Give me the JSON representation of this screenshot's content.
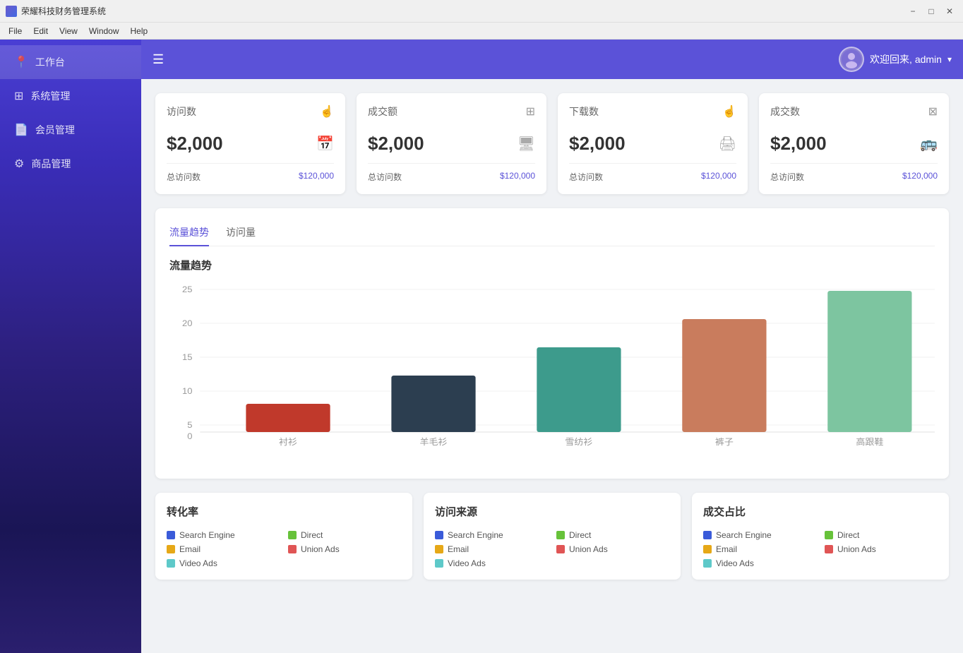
{
  "titleBar": {
    "title": "荣耀科技财务管理系统",
    "controls": [
      "minimize",
      "maximize",
      "close"
    ]
  },
  "menuBar": {
    "items": [
      "File",
      "Edit",
      "View",
      "Window",
      "Help"
    ]
  },
  "sidebar": {
    "items": [
      {
        "id": "workspace",
        "label": "工作台",
        "icon": "📍",
        "active": true
      },
      {
        "id": "system",
        "label": "系统管理",
        "icon": "⚙️",
        "active": false
      },
      {
        "id": "member",
        "label": "会员管理",
        "icon": "📄",
        "active": false
      },
      {
        "id": "product",
        "label": "商品管理",
        "icon": "⚙️",
        "active": false
      }
    ]
  },
  "header": {
    "welcome": "欢迎回来, admin"
  },
  "statCards": [
    {
      "title": "访问数",
      "value": "$2,000",
      "footerLabel": "总访问数",
      "footerValue": "$120,000",
      "icon": "☝",
      "icon2": "📅"
    },
    {
      "title": "成交额",
      "value": "$2,000",
      "footerLabel": "总访问数",
      "footerValue": "$120,000",
      "icon": "⬜",
      "icon2": "🖥"
    },
    {
      "title": "下载数",
      "value": "$2,000",
      "footerLabel": "总访问数",
      "footerValue": "$120,000",
      "icon": "☝",
      "icon2": "🖨"
    },
    {
      "title": "成交数",
      "value": "$2,000",
      "footerLabel": "总访问数",
      "footerValue": "$120,000",
      "icon": "⬜",
      "icon2": "🚌"
    }
  ],
  "chartSection": {
    "tabs": [
      "流量趋势",
      "访问量"
    ],
    "activeTab": 0,
    "title": "流量趋势",
    "yLabels": [
      "25",
      "20",
      "15",
      "10",
      "5",
      "0"
    ],
    "bars": [
      {
        "label": "衬衫",
        "value": 5,
        "color": "#c0392b",
        "maxValue": 25
      },
      {
        "label": "羊毛衫",
        "value": 10,
        "color": "#2c3e50",
        "maxValue": 25
      },
      {
        "label": "雪纺衫",
        "value": 15,
        "color": "#3d9b8c",
        "maxValue": 25
      },
      {
        "label": "裤子",
        "value": 20,
        "color": "#c97c5d",
        "maxValue": 25
      },
      {
        "label": "高跟鞋",
        "value": 25,
        "color": "#7dc5a0",
        "maxValue": 25
      }
    ]
  },
  "bottomCards": [
    {
      "title": "转化率",
      "legends": [
        {
          "label": "Search Engine",
          "color": "#3a5bd9"
        },
        {
          "label": "Direct",
          "color": "#67c23a"
        },
        {
          "label": "Email",
          "color": "#e6a817"
        },
        {
          "label": "Union Ads",
          "color": "#e05555"
        },
        {
          "label": "Video Ads",
          "color": "#5ec9c9"
        }
      ]
    },
    {
      "title": "访问来源",
      "legends": [
        {
          "label": "Search Engine",
          "color": "#3a5bd9"
        },
        {
          "label": "Direct",
          "color": "#67c23a"
        },
        {
          "label": "Email",
          "color": "#e6a817"
        },
        {
          "label": "Union Ads",
          "color": "#e05555"
        },
        {
          "label": "Video Ads",
          "color": "#5ec9c9"
        }
      ]
    },
    {
      "title": "成交占比",
      "legends": [
        {
          "label": "Search Engine",
          "color": "#3a5bd9"
        },
        {
          "label": "Direct",
          "color": "#67c23a"
        },
        {
          "label": "Email",
          "color": "#e6a817"
        },
        {
          "label": "Union Ads",
          "color": "#e05555"
        },
        {
          "label": "Video Ads",
          "color": "#5ec9c9"
        }
      ]
    }
  ]
}
